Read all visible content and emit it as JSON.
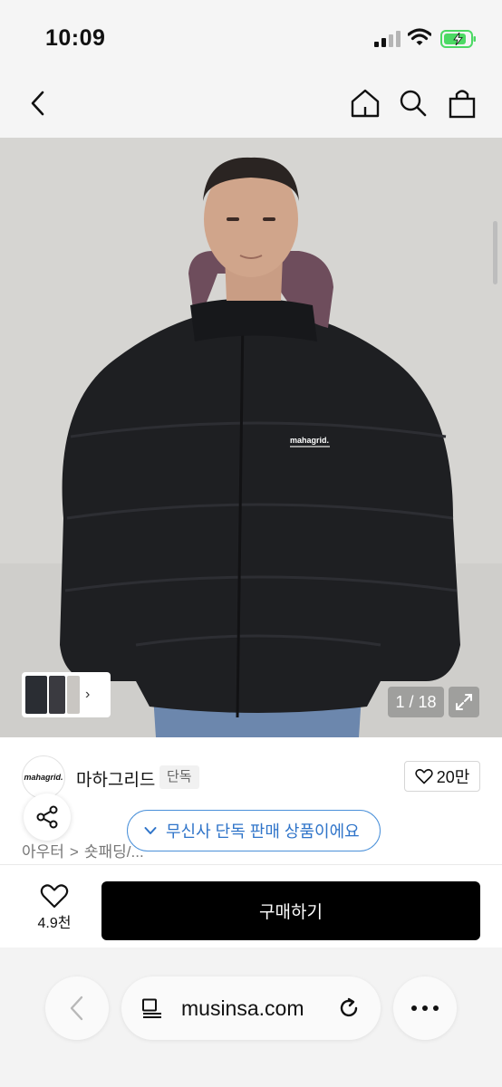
{
  "status_bar": {
    "time": "10:09"
  },
  "nav": {
    "icons": [
      "back-icon",
      "home-icon",
      "search-icon",
      "shopping-bag-icon"
    ]
  },
  "gallery": {
    "counter": "1 / 18",
    "thumbnail_more": "›",
    "chest_logo": "mahagrid."
  },
  "brand": {
    "logo_text": "mahagrid.",
    "name": "마하그리드",
    "badge": "단독",
    "likes": "20만"
  },
  "breadcrumb": {
    "items": [
      "아우터",
      "숏패딩/..."
    ],
    "separator": ">"
  },
  "notice": {
    "text": "무신사 단독 판매 상품이에요"
  },
  "purchase": {
    "wishlist_count": "4.9천",
    "buy_label": "구매하기"
  },
  "browser": {
    "url": "musinsa.com"
  },
  "colors": {
    "buy_button": "#000000",
    "notice_accent": "#2f74c9",
    "status_bg": "#f5f5f5",
    "battery_green": "#4cd964"
  }
}
